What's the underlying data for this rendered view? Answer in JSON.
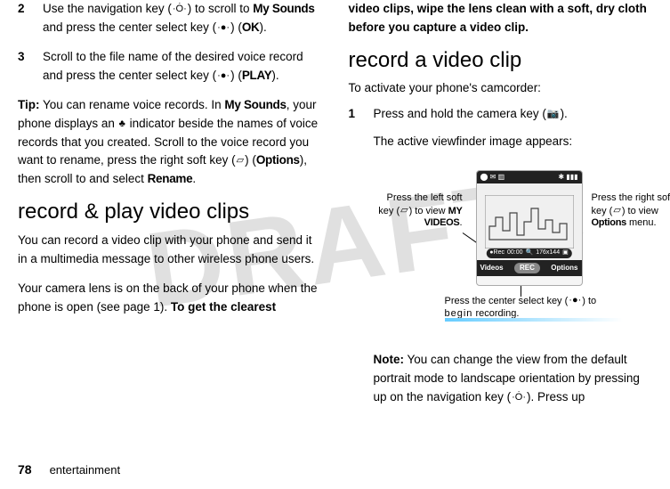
{
  "watermark": "DRAFT",
  "left": {
    "step2_num": "2",
    "step2_body_a": "Use the navigation key (",
    "step2_body_b": ") to scroll to ",
    "step2_body_c": "My Sounds",
    "step2_body_d": " and press the center select key (",
    "step2_body_e": ") (",
    "step2_body_f": "OK",
    "step2_body_g": ").",
    "step3_num": "3",
    "step3_body_a": "Scroll to the file name of the desired voice record and press the center select key (",
    "step3_body_b": ") (",
    "step3_body_c": "PLAY",
    "step3_body_d": ").",
    "tip_label": "Tip:",
    "tip_a": " You can rename voice records. In ",
    "tip_b": "My Sounds",
    "tip_c": ", your phone displays an ",
    "tip_d": " indicator beside the names of voice records that you created. Scroll to the voice record you want to rename, press the right soft key (",
    "tip_e": ") (",
    "tip_f": "Options",
    "tip_g": "), then scroll to and select ",
    "tip_h": "Rename",
    "tip_i": ".",
    "heading": "record & play video clips",
    "para1": "You can record a video clip with your phone and send it in a multimedia message to other wireless phone users.",
    "para2_a": "Your camera lens is on the back of your phone when the phone is open (see page 1). ",
    "para2_b": "To get the clearest "
  },
  "right": {
    "cont_bold": "video clips, wipe the lens clean with a soft, dry cloth before you capture a video clip.",
    "heading": "record a video clip",
    "intro": "To activate your phone's camcorder:",
    "step1_num": "1",
    "step1_a": "Press and hold the camera key (",
    "step1_b": ").",
    "step1_after": "The active viewfinder image appears:",
    "annot_left_a": "Press the left soft key (",
    "annot_left_b": ") to view ",
    "annot_left_c": "MY VIDEOS",
    "annot_left_d": ".",
    "annot_right_a": "Press the right soft key (",
    "annot_right_b": ") to view ",
    "annot_right_c": "Options",
    "annot_right_d": " menu.",
    "annot_bottom_a": "Press the center select key (",
    "annot_bottom_b": ") to ",
    "annot_bottom_c": "begin",
    "annot_bottom_d": " recording.",
    "vf_top_left": "⬤ ✉ ▥",
    "vf_top_right": "✱ ▮▮▮",
    "vf_info_rec": "●Rec",
    "vf_info_time": "00:00",
    "vf_info_zoom": "🔍",
    "vf_info_res": "176x144",
    "vf_info_ico": "▣",
    "vf_bot_left": "Videos",
    "vf_bot_mid": "REC",
    "vf_bot_right": "Options",
    "note_label": "Note:",
    "note_a": " You can change the view from the default portrait mode to landscape orientation by pressing up on the navigation key (",
    "note_b": "). Press up"
  },
  "icons": {
    "nav": "·Ȯ·",
    "center": "·●·",
    "mic": "♣",
    "soft_right": "▱",
    "soft_left": "▱",
    "camera": "📷"
  },
  "footer": {
    "page": "78",
    "section": "entertainment"
  }
}
